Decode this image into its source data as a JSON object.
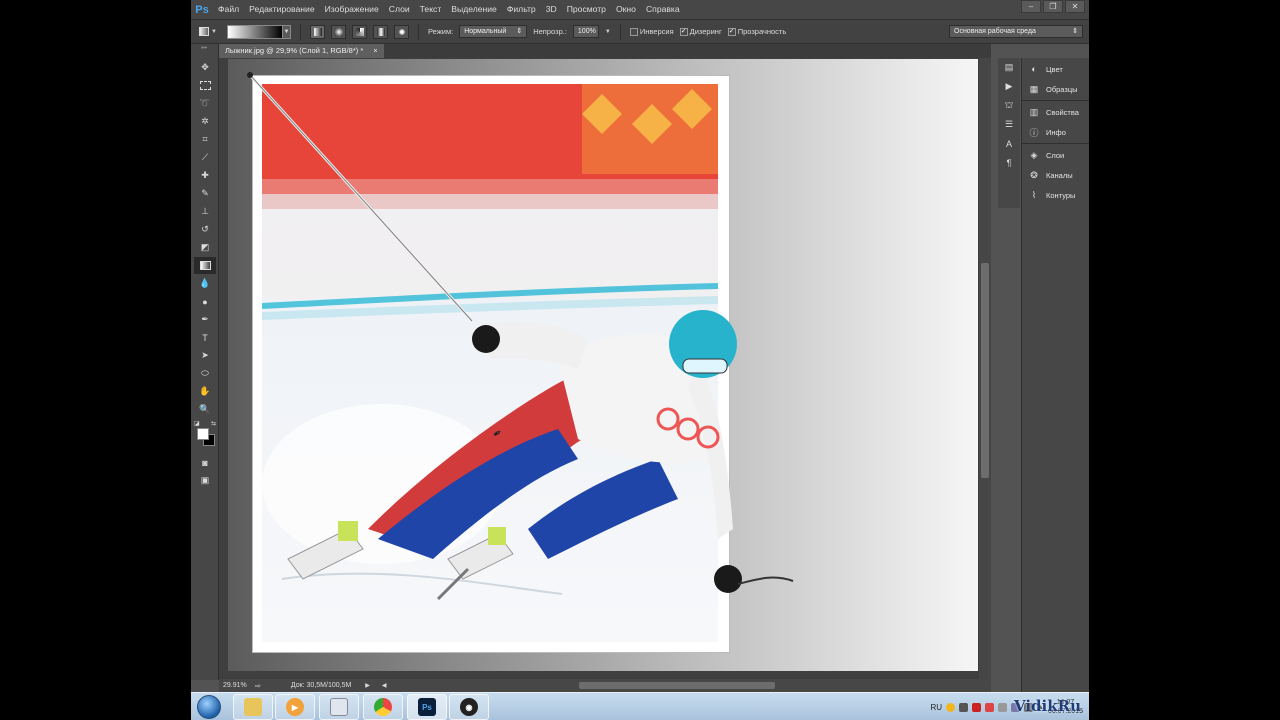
{
  "app": {
    "logo": "Ps",
    "menu": [
      "Файл",
      "Редактирование",
      "Изображение",
      "Слои",
      "Текст",
      "Выделение",
      "Фильтр",
      "3D",
      "Просмотр",
      "Окно",
      "Справка"
    ],
    "window_controls": [
      "–",
      "❐",
      "✕"
    ]
  },
  "options": {
    "mode_label": "Режим:",
    "mode_value": "Нормальный",
    "opacity_label": "Непрозр.:",
    "opacity_value": "100%",
    "invert_label": "Инверсия",
    "dither_label": "Дизеринг",
    "transparency_label": "Прозрачность",
    "workspace_value": "Основная рабочая среда"
  },
  "document": {
    "tab_title": "Лыжник.jpg @ 29,9% (Слой 1, RGB/8*) *",
    "tab_close": "×",
    "zoom": "29.91%",
    "doc_info": "Док: 30,5M/100,5M"
  },
  "panels": [
    {
      "items": [
        {
          "icon": "color-icon",
          "label": "Цвет"
        },
        {
          "icon": "swatches-icon",
          "label": "Образцы"
        }
      ]
    },
    {
      "items": [
        {
          "icon": "properties-icon",
          "label": "Свойства"
        },
        {
          "icon": "info-icon",
          "label": "Инфо"
        }
      ]
    },
    {
      "items": [
        {
          "icon": "layers-icon",
          "label": "Слои"
        },
        {
          "icon": "channels-icon",
          "label": "Каналы"
        },
        {
          "icon": "paths-icon",
          "label": "Контуры"
        }
      ]
    }
  ],
  "taskbar": {
    "lang": "RU",
    "clock_time": "18:07",
    "clock_date": "06.07.2015",
    "watermark": "VidikRu"
  }
}
